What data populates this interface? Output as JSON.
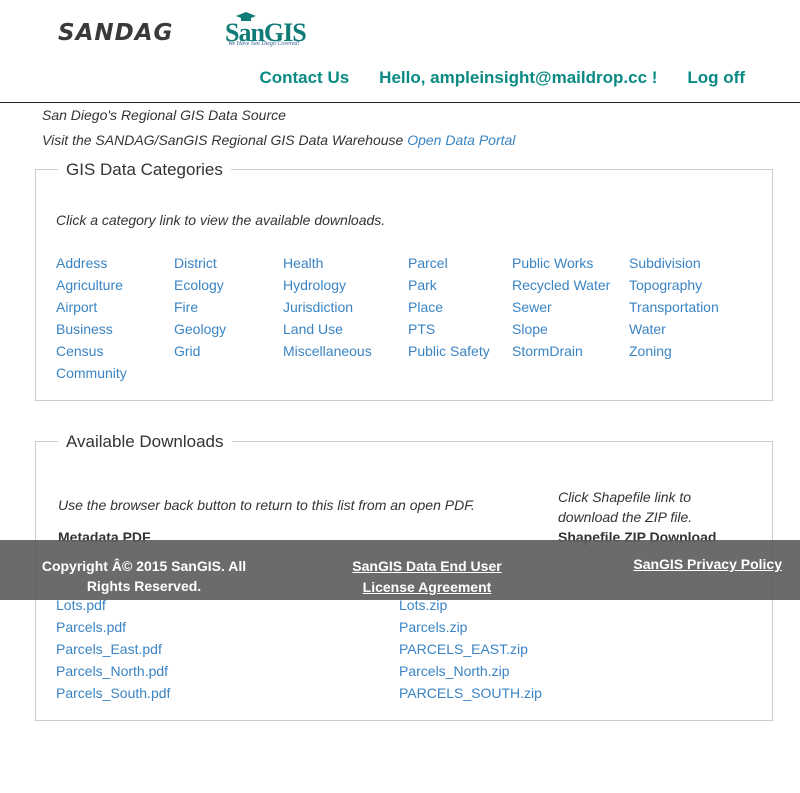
{
  "header": {
    "logo_sandag": "SANDAG",
    "logo_sangis": "SanGIS",
    "logo_sangis_tagline": "We Have San Diego Covered!",
    "nav": {
      "contact": "Contact Us",
      "greeting": "Hello, ampleinsight@maildrop.cc !",
      "logoff": "Log off"
    }
  },
  "intro": {
    "line1": "San Diego's Regional GIS Data Source",
    "line2": "Visit the SANDAG/SanGIS Regional GIS Data Warehouse",
    "portal_link": "Open Data Portal"
  },
  "categories": {
    "title": "GIS Data Categories",
    "hint": "Click a category link to view the available downloads.",
    "columns": [
      [
        "Address",
        "Agriculture",
        "Airport",
        "Business",
        "Census",
        "Community"
      ],
      [
        "District",
        "Ecology",
        "Fire",
        "Geology",
        "Grid"
      ],
      [
        "Health",
        "Hydrology",
        "Jurisdiction",
        "Land Use",
        "Miscellaneous"
      ],
      [
        "Parcel",
        "Park",
        "Place",
        "PTS",
        "Public Safety"
      ],
      [
        "Public Works",
        "Recycled Water",
        "Sewer",
        "Slope",
        "StormDrain"
      ],
      [
        "Subdivision",
        "Topography",
        "Transportation",
        "Water",
        "Zoning"
      ]
    ]
  },
  "downloads": {
    "title": "Available Downloads",
    "hint_left": "Use the browser back button to return to this list from an open PDF.",
    "hint_right": "Click Shapefile link to download the ZIP file.",
    "header_left": "Metadata PDF",
    "header_right": "Shapefile ZIP Download",
    "pdf_files": [
      "Lots.pdf",
      "Parcels.pdf",
      "Parcels_East.pdf",
      "Parcels_North.pdf",
      "Parcels_South.pdf"
    ],
    "zip_files": [
      "Lots.zip",
      "Parcels.zip",
      "PARCELS_EAST.zip",
      "Parcels_North.zip",
      "PARCELS_SOUTH.zip"
    ]
  },
  "footer": {
    "copyright": "Copyright Â© 2015 SanGIS. All Rights Reserved.",
    "license_link": "SanGIS Data End User License Agreement",
    "privacy_link": "SanGIS Privacy Policy"
  },
  "colors": {
    "nav_teal": "#0a8a83",
    "link_blue": "#3a84c4",
    "footer_gray": "#5e5e5e"
  }
}
